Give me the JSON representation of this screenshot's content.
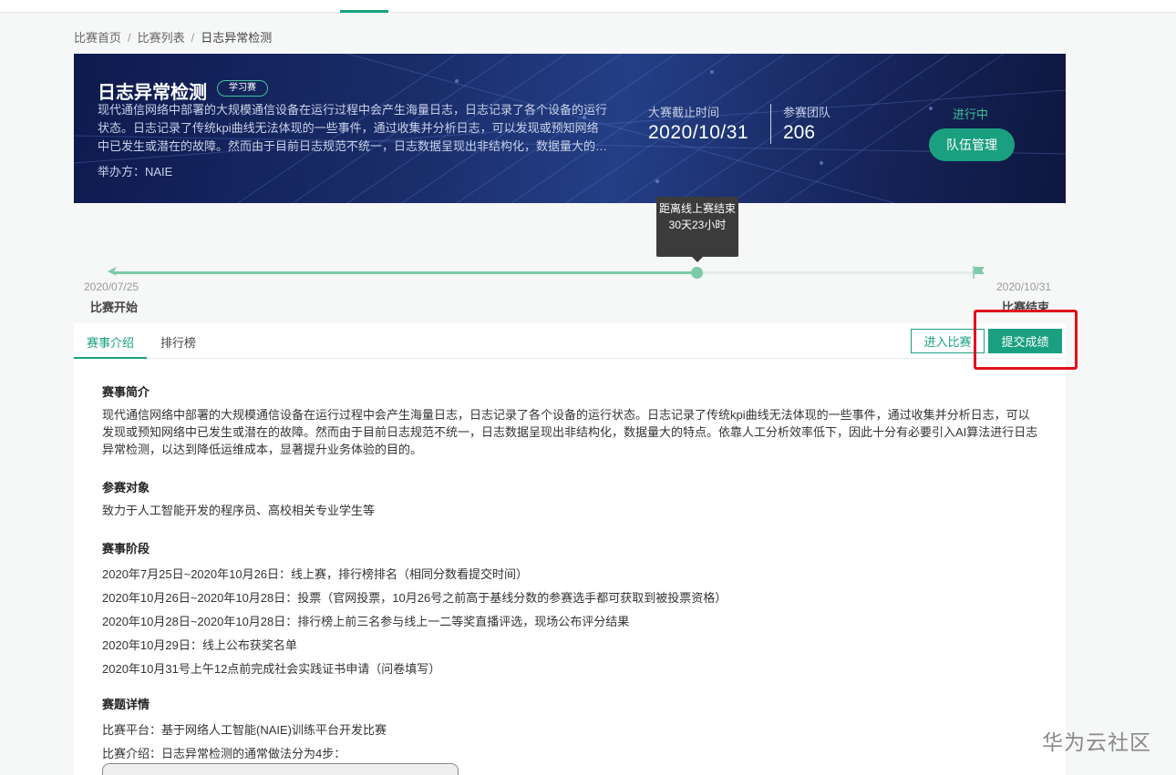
{
  "breadcrumb": {
    "items": [
      "比赛首页",
      "比赛列表",
      "日志异常检测"
    ],
    "separator": "/"
  },
  "banner": {
    "title": "日志异常检测",
    "tag": "学习赛",
    "description": "现代通信网络中部署的大规模通信设备在运行过程中会产生海量日志，日志记录了各个设备的运行状态。日志记录了传统kpi曲线无法体现的一些事件，通过收集并分析日志，可以发现或预知网络中已发生或潜在的故障。然而由于目前日志规范不统一，日志数据呈现出非结构化，数据量大的…",
    "organizer": "举办方：NAIE",
    "deadline_label": "大赛截止时间",
    "deadline_value": "2020/10/31",
    "teams_label": "参赛团队",
    "teams_value": "206",
    "status": "进行中",
    "team_button": "队伍管理"
  },
  "timeline": {
    "tooltip": "距离线上赛结束30天23小时",
    "start_date": "2020/07/25",
    "start_label": "比赛开始",
    "end_date": "2020/10/31",
    "end_label": "比赛结束",
    "progress": 0.67
  },
  "tabs": [
    {
      "label": "赛事介绍",
      "active": true
    },
    {
      "label": "排行榜",
      "active": false
    }
  ],
  "actions": {
    "enter_label": "进入比赛",
    "submit_label": "提交成绩"
  },
  "content": {
    "intro_title": "赛事简介",
    "intro_text": "现代通信网络中部署的大规模通信设备在运行过程中会产生海量日志，日志记录了各个设备的运行状态。日志记录了传统kpi曲线无法体现的一些事件，通过收集并分析日志，可以发现或预知网络中已发生或潜在的故障。然而由于目前日志规范不统一，日志数据呈现出非结构化，数据量大的特点。依靠人工分析效率低下，因此十分有必要引入AI算法进行日志异常检测，以达到降低运维成本，显著提升业务体验的目的。",
    "target_title": "参赛对象",
    "target_text": "致力于人工智能开发的程序员、高校相关专业学生等",
    "stage_title": "赛事阶段",
    "stages": [
      "2020年7月25日~2020年10月26日：线上赛，排行榜排名（相同分数看提交时间）",
      "2020年10月26日~2020年10月28日：投票（官网投票，10月26号之前高于基线分数的参赛选手都可获取到被投票资格）",
      "2020年10月28日~2020年10月28日：排行榜上前三名参与线上一二等奖直播评选，现场公布评分结果",
      "2020年10月29日：线上公布获奖名单",
      "2020年10月31号上午12点前完成社会实践证书申请（问卷填写）"
    ],
    "detail_title": "赛题详情",
    "platform": "比赛平台：基于网络人工智能(NAIE)训练平台开发比赛",
    "method": "比赛介绍：日志异常检测的通常做法分为4步："
  },
  "watermark": "华为云社区",
  "colors": {
    "accent": "#1aa081",
    "highlight": "#e0111d",
    "banner_bg": "#16245a"
  }
}
